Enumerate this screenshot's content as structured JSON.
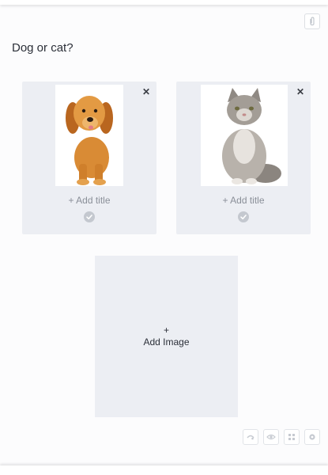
{
  "question": {
    "title": "Dog or cat?"
  },
  "options": [
    {
      "image_icon": "puppy-photo",
      "add_title_label": "+ Add title"
    },
    {
      "image_icon": "cat-photo",
      "add_title_label": "+ Add title"
    }
  ],
  "add_image": {
    "plus": "+",
    "label": "Add Image"
  },
  "colors": {
    "card_bg": "#eceef3",
    "check": "#c4c8cf",
    "text": "#2b2f38",
    "muted": "#8a8f98"
  },
  "icons": {
    "attach": "paperclip-icon",
    "close": "close-icon",
    "check": "check-circle-icon",
    "tools": [
      "pin-icon",
      "eye-icon",
      "expand-icon",
      "gear-icon"
    ]
  }
}
